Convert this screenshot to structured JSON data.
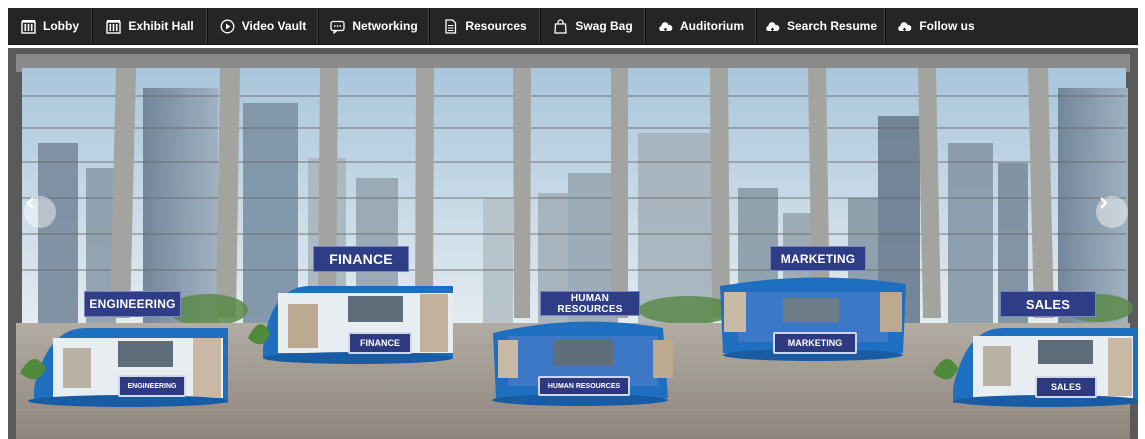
{
  "nav": {
    "items": [
      {
        "label": "Lobby",
        "icon": "building-icon"
      },
      {
        "label": "Exhibit Hall",
        "icon": "building-icon"
      },
      {
        "label": "Video Vault",
        "icon": "play-circle-icon"
      },
      {
        "label": "Networking",
        "icon": "chat-bubble-icon"
      },
      {
        "label": "Resources",
        "icon": "document-icon"
      },
      {
        "label": "Swag Bag",
        "icon": "shopping-bag-icon"
      },
      {
        "label": "Auditorium",
        "icon": "cloud-icon"
      },
      {
        "label": "Search Resume",
        "icon": "cloud-icon"
      },
      {
        "label": "Follow us",
        "icon": "cloud-icon"
      }
    ]
  },
  "hall": {
    "booths": {
      "engineering": {
        "label": "ENGINEERING",
        "sign": "ENGINEERING"
      },
      "finance": {
        "label": "FINANCE",
        "sign": "FINANCE"
      },
      "human_resources": {
        "label": "HUMAN RESOURCES",
        "sign": "HUMAN RESOURCES"
      },
      "marketing": {
        "label": "MARKETING",
        "sign": "MARKETING"
      },
      "sales": {
        "label": "SALES",
        "sign": "SALES"
      }
    },
    "prev_icon": "chevron-left-icon",
    "next_icon": "chevron-right-icon"
  },
  "colors": {
    "nav_bg": "#252525",
    "label_bg": "#2f3d86",
    "booth_blue": "#1f6fc0",
    "sky": "#c9dbe8"
  }
}
